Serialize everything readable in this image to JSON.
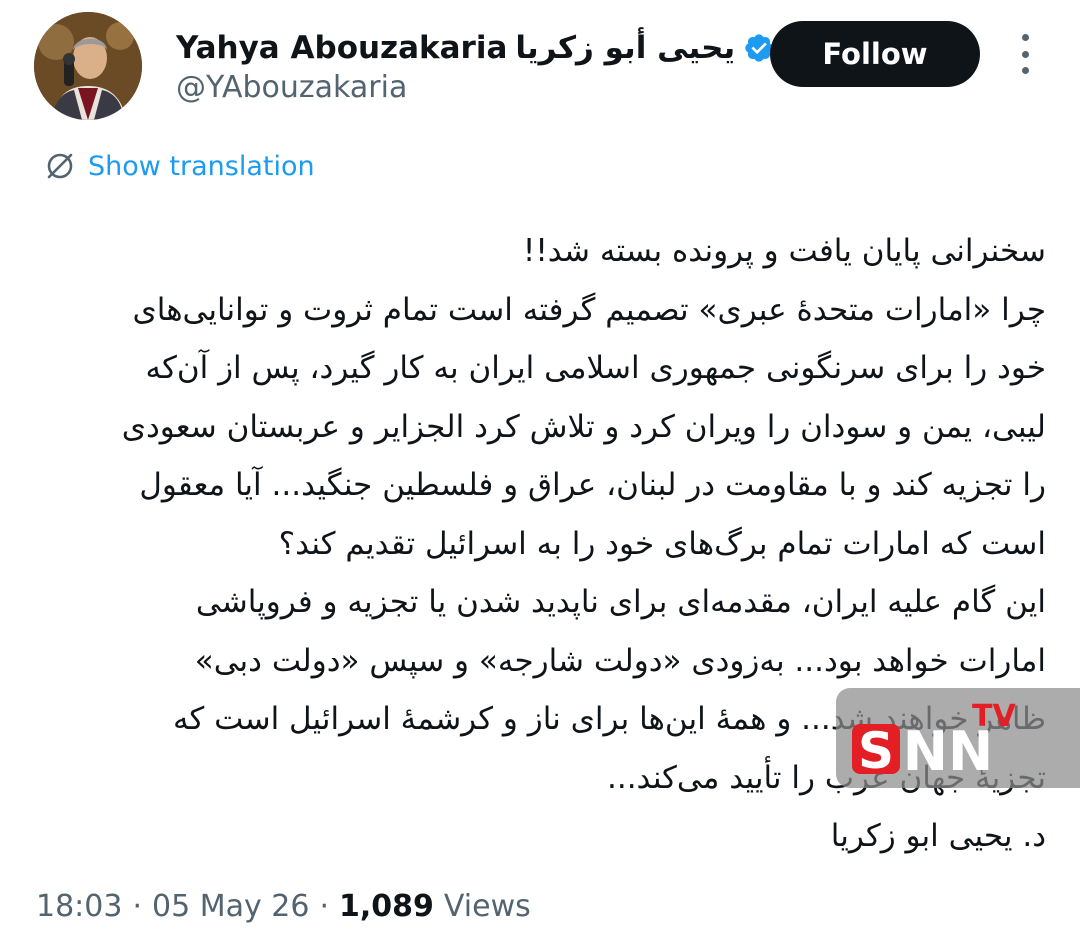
{
  "author": {
    "name": "Yahya Abouzakaria",
    "name_ar": "يحيى أبو زكريا",
    "handle": "@YAbouzakaria",
    "verified_icon": "verified-badge-icon",
    "verified_color": "#1d9bf0"
  },
  "actions": {
    "follow_label": "Follow",
    "more_icon": "more-vertical-icon"
  },
  "translate": {
    "label": "Show translation",
    "icon": "translate-icon",
    "color": "#1d9bf0"
  },
  "tweet": {
    "lines": [
      "سخنرانی پایان یافت و پرونده بسته شد!!",
      "چرا «امارات متحدۀ عبری» تصمیم گرفته است تمام ثروت و توانایی‌های",
      "خود را برای سرنگونی جمهوری اسلامی ایران به کار گیرد، پس از آن‌که",
      "لیبی، یمن و سودان را ویران کرد و تلاش کرد الجزایر و عربستان سعودی",
      "را تجزیه کند و با مقاومت در لبنان، عراق و فلسطین جنگید... آیا معقول",
      "است که امارات تمام برگ‌های خود را به اسرائیل تقدیم کند؟",
      "این گام علیه ایران، مقدمه‌ای برای ناپدید شدن یا تجزیه و فروپاشی",
      "امارات خواهد بود... به‌زودی «دولت شارجه» و سپس «دولت دبی»",
      "ظاهر خواهند شد... و همهٔ این‌ها برای ناز و کرشمهٔ اسرائیل است که",
      "تجزیهٔ جهان عرب را تأیید می‌کند...",
      "د. یحیی ابو زکریا"
    ]
  },
  "meta": {
    "time": "18:03",
    "date": "05 May 26",
    "sep": "·",
    "views_count": "1,089",
    "views_label": "Views"
  },
  "watermark": {
    "text": "SNN",
    "tv": "TV",
    "accent": "#e31e24"
  }
}
